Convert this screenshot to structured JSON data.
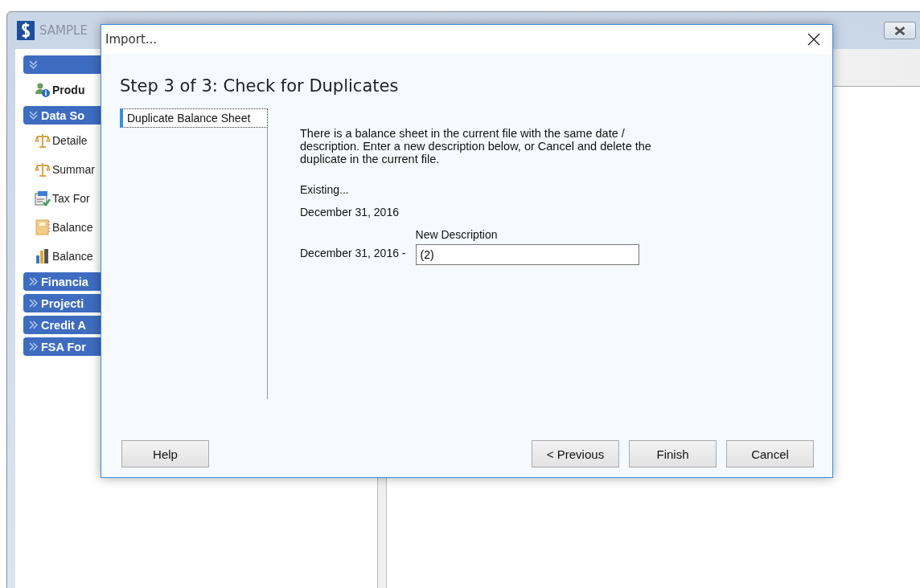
{
  "app": {
    "title": "SAMPLE"
  },
  "sidebar": {
    "items": [
      {
        "kind": "header",
        "expanded": true
      },
      {
        "kind": "product",
        "label": "Produ",
        "selected": true
      },
      {
        "kind": "header",
        "label": "Data So",
        "expanded": true
      },
      {
        "kind": "scale",
        "label": "Detaile",
        "selected": false
      },
      {
        "kind": "scale",
        "label": "Summar",
        "selected": false
      },
      {
        "kind": "form",
        "label": "Tax For",
        "selected": false
      },
      {
        "kind": "book",
        "label": "Balance",
        "selected": false
      },
      {
        "kind": "chart",
        "label": "Balance",
        "selected": false
      },
      {
        "kind": "header",
        "label": "Financia",
        "expanded": false
      },
      {
        "kind": "header",
        "label": "Projecti",
        "expanded": false
      },
      {
        "kind": "header",
        "label": "Credit A",
        "expanded": false
      },
      {
        "kind": "header",
        "label": "FSA For",
        "expanded": false
      }
    ]
  },
  "dialog": {
    "title": "Import...",
    "heading": "Step 3 of 3: Check for Duplicates",
    "steps": [
      {
        "label": "Duplicate Balance Sheet",
        "selected": true
      }
    ],
    "message": "There is a balance sheet in the current file with the same date / description. Enter a new description below, or Cancel and delete the duplicate in the current file.",
    "existing_label": "Existing...",
    "existing_value": "December 31, 2016",
    "new_label": "New Description",
    "new_prefix": "December 31, 2016 -",
    "new_value": "(2)",
    "buttons": {
      "left": [
        "Help"
      ],
      "right": [
        "< Previous",
        "Finish",
        "Cancel"
      ]
    }
  }
}
